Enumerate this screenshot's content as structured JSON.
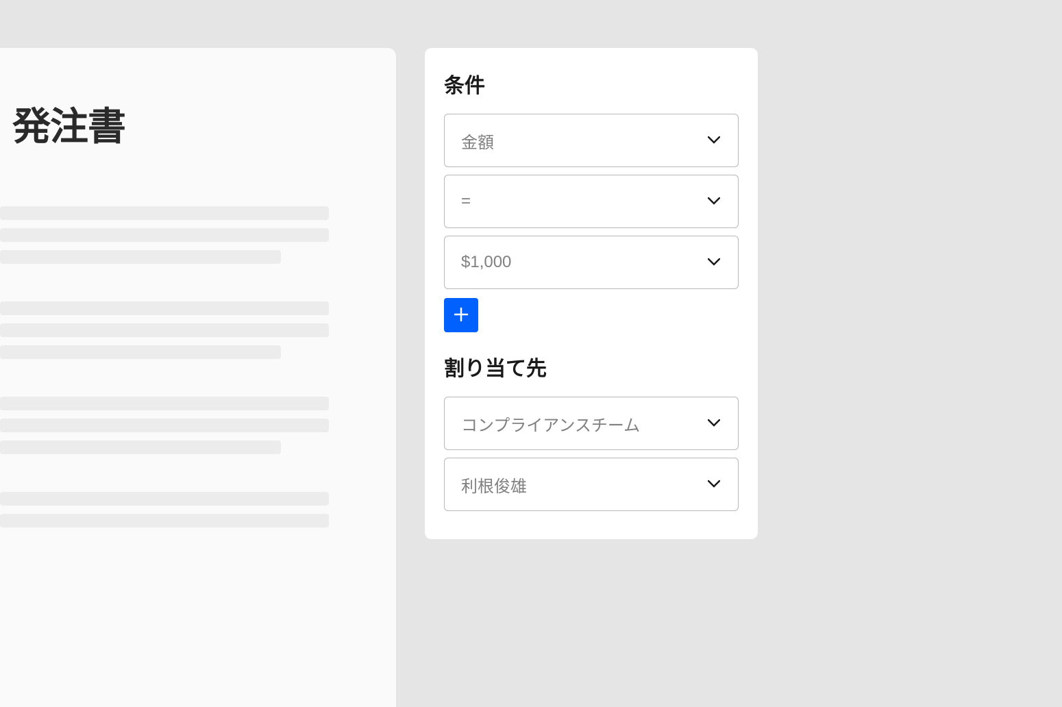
{
  "document": {
    "title": "発注書"
  },
  "conditions": {
    "heading": "条件",
    "fields": [
      {
        "value": "金額"
      },
      {
        "value": "="
      },
      {
        "value": "$1,000"
      }
    ]
  },
  "assignment": {
    "heading": "割り当て先",
    "fields": [
      {
        "value": "コンプライアンスチーム"
      },
      {
        "value": "利根俊雄"
      }
    ]
  }
}
